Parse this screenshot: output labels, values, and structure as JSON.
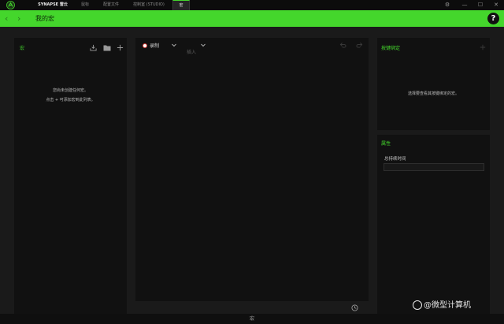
{
  "titlebar": {
    "tabs": [
      "SYNAPSE 雷云",
      "鼠标",
      "配置文件",
      "控制室 (STUDIO)",
      "宏"
    ],
    "window_buttons": [
      "⚙",
      "—",
      "☐",
      "✕"
    ]
  },
  "header": {
    "title": "我的宏",
    "help": "?",
    "back": "‹",
    "forward": "›"
  },
  "left_panel": {
    "title": "宏",
    "empty_line1": "您尚未创建任何宏。",
    "empty_line2": "点击 + 可添加宏到此列表。"
  },
  "center_panel": {
    "record_label": "录制",
    "insert_label": "插入"
  },
  "right_top": {
    "title": "按键绑定",
    "message": "选择要查看其按键绑定的宏。"
  },
  "right_bottom": {
    "title": "属性",
    "field_label": "总持续时间",
    "field_value": ""
  },
  "bottombar": {
    "label": "宏"
  },
  "watermark": {
    "text": "@微型计算机"
  },
  "colors": {
    "accent": "#44d62c",
    "panel_bg": "#111111",
    "page_bg": "#1a1a1a",
    "record_dot": "#e0403a"
  }
}
